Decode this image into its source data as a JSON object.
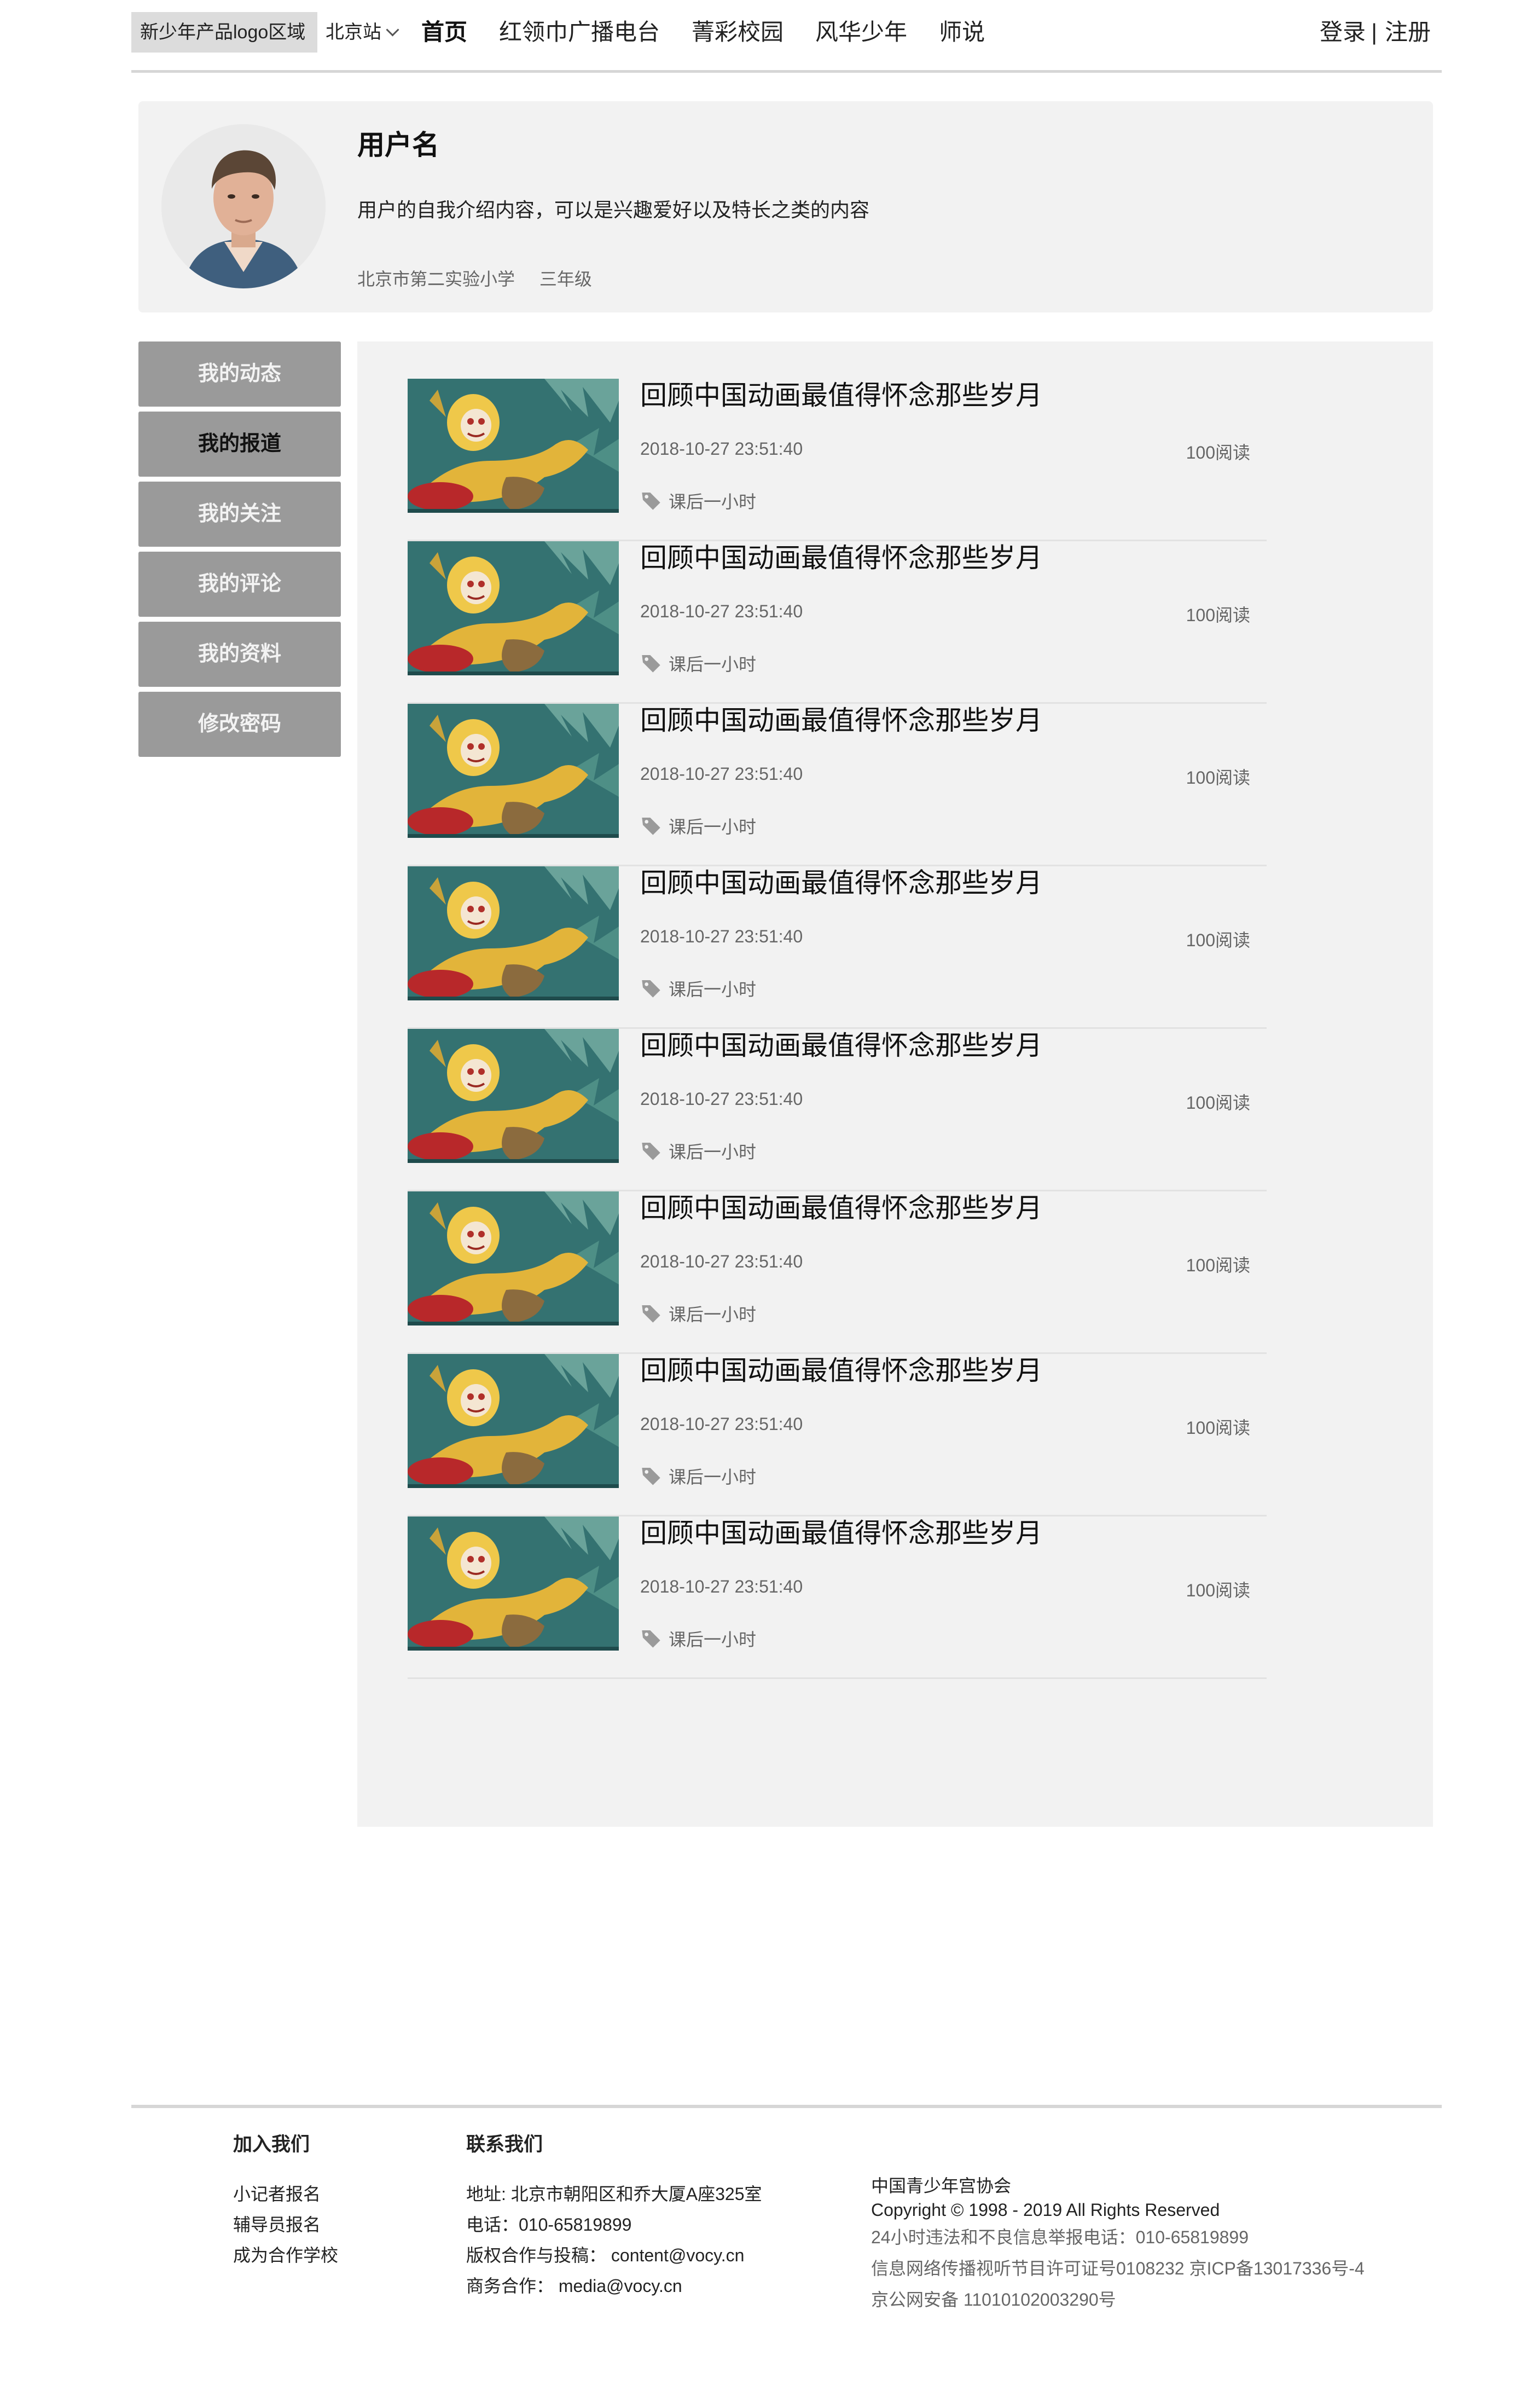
{
  "header": {
    "logo_text": "新少年产品logo区域",
    "city": "北京站",
    "nav": [
      "首页",
      "红领巾广播电台",
      "菁彩校园",
      "风华少年",
      "师说"
    ],
    "login": "登录",
    "separator": "|",
    "register": "注册"
  },
  "profile": {
    "username": "用户名",
    "bio": "用户的自我介绍内容，可以是兴趣爱好以及特长之类的内容",
    "school": "北京市第二实验小学",
    "grade": "三年级"
  },
  "side_menu": {
    "items": [
      "我的动态",
      "我的报道",
      "我的关注",
      "我的评论",
      "我的资料",
      "修改密码"
    ],
    "active": "我的报道"
  },
  "articles": [
    {
      "title": "回顾中国动画最值得怀念那些岁月",
      "date": "2018-10-27 23:51:40",
      "reads": "100阅读",
      "tag": "课后一小时"
    },
    {
      "title": "回顾中国动画最值得怀念那些岁月",
      "date": "2018-10-27 23:51:40",
      "reads": "100阅读",
      "tag": "课后一小时"
    },
    {
      "title": "回顾中国动画最值得怀念那些岁月",
      "date": "2018-10-27 23:51:40",
      "reads": "100阅读",
      "tag": "课后一小时"
    },
    {
      "title": "回顾中国动画最值得怀念那些岁月",
      "date": "2018-10-27 23:51:40",
      "reads": "100阅读",
      "tag": "课后一小时"
    },
    {
      "title": "回顾中国动画最值得怀念那些岁月",
      "date": "2018-10-27 23:51:40",
      "reads": "100阅读",
      "tag": "课后一小时"
    },
    {
      "title": "回顾中国动画最值得怀念那些岁月",
      "date": "2018-10-27 23:51:40",
      "reads": "100阅读",
      "tag": "课后一小时"
    },
    {
      "title": "回顾中国动画最值得怀念那些岁月",
      "date": "2018-10-27 23:51:40",
      "reads": "100阅读",
      "tag": "课后一小时"
    },
    {
      "title": "回顾中国动画最值得怀念那些岁月",
      "date": "2018-10-27 23:51:40",
      "reads": "100阅读",
      "tag": "课后一小时"
    }
  ],
  "footer": {
    "join": {
      "title": "加入我们",
      "links": [
        "小记者报名",
        "辅导员报名",
        "成为合作学校"
      ]
    },
    "contact": {
      "title": "联系我们",
      "lines": [
        "地址: 北京市朝阳区和乔大厦A座325室",
        "电话：010-65819899",
        "版权合作与投稿：  content@vocy.cn",
        "商务合作：  media@vocy.cn"
      ]
    },
    "info": {
      "lines": [
        "中国青少年宫协会",
        "Copyright © 1998 - 2019 All Rights Reserved",
        "24小时违法和不良信息举报电话：010-65819899",
        "信息网络传播视听节目许可证号0108232 京ICP备13017336号-4",
        "京公网安备 11010102003290号"
      ]
    }
  },
  "colors": {
    "panel_bg": "#f2f2f2",
    "menu_bg": "#9a9a9a",
    "menu_text": "#f3f3f3",
    "logo_bg": "#dcdcdc",
    "divider": "#d6d6d6"
  },
  "icons": {
    "tag": "tag-icon",
    "city_dropdown": "chevron-down-icon"
  }
}
